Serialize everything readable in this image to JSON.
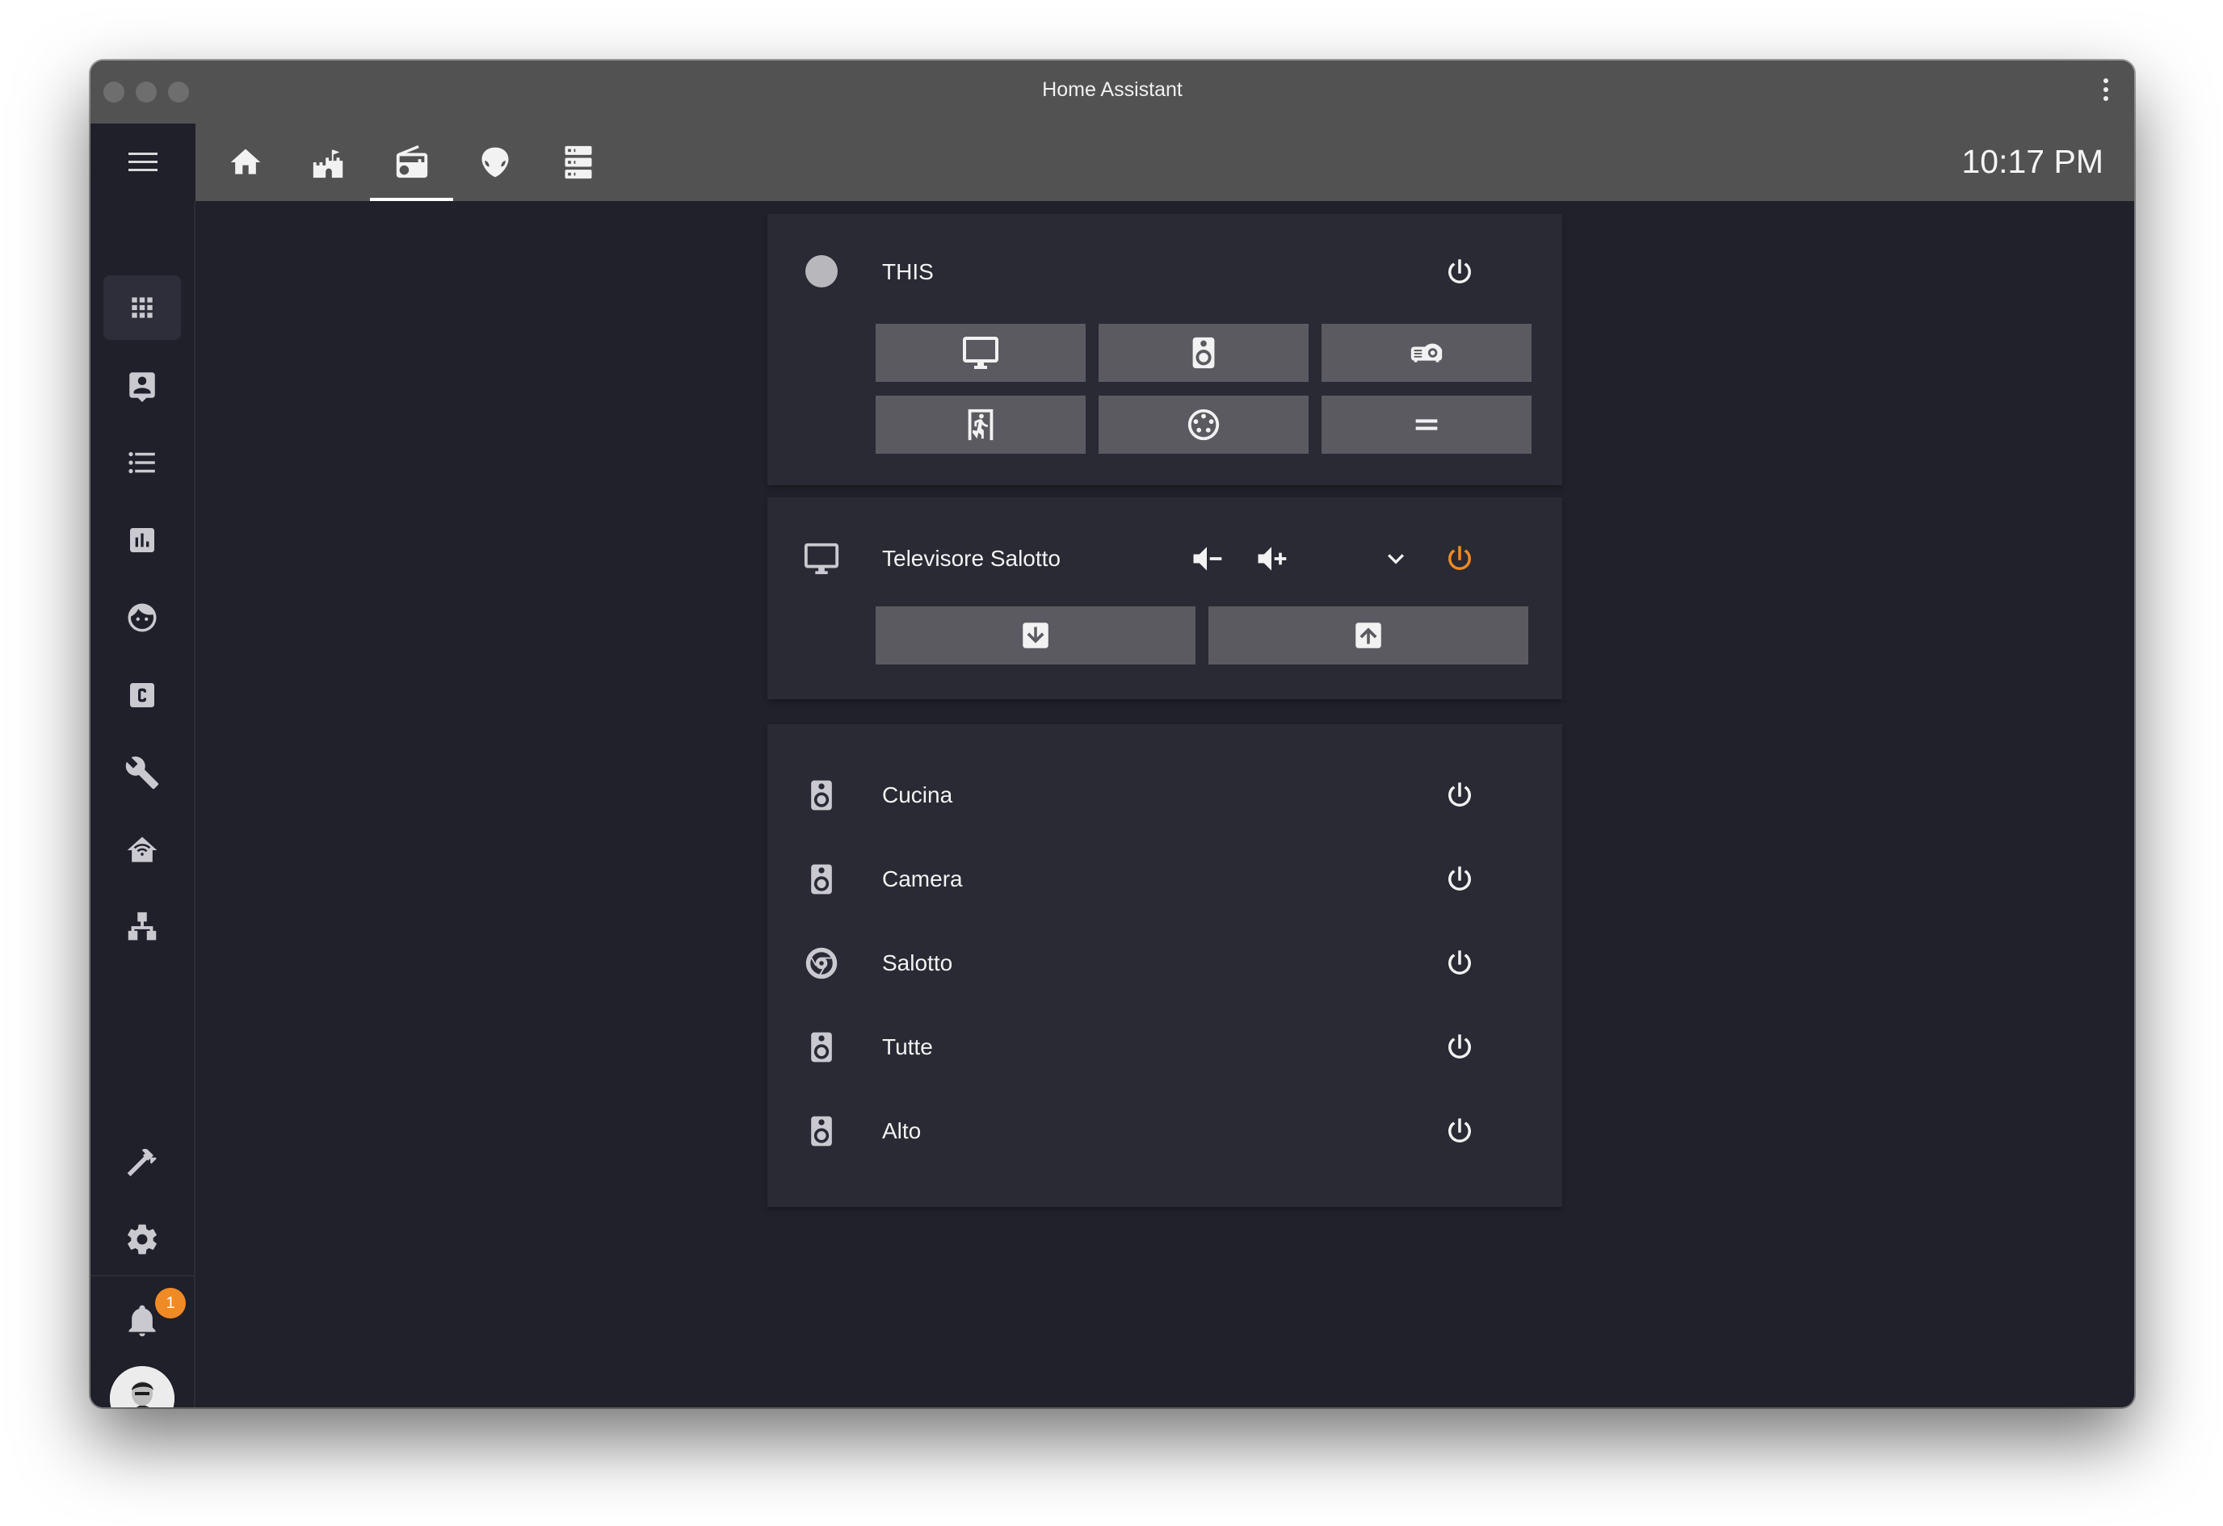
{
  "window": {
    "title": "Home Assistant"
  },
  "toolbar": {
    "clock": "10:17 PM",
    "tabs": [
      {
        "icon": "home-icon"
      },
      {
        "icon": "castle-icon"
      },
      {
        "icon": "radio-icon",
        "active": true
      },
      {
        "icon": "alien-icon"
      },
      {
        "icon": "server-icon"
      }
    ]
  },
  "sidebar": {
    "items": [
      {
        "icon": "apps-icon",
        "active": true
      },
      {
        "icon": "account-box-icon"
      },
      {
        "icon": "format-list-icon"
      },
      {
        "icon": "chart-box-icon"
      },
      {
        "icon": "face-icon"
      },
      {
        "icon": "alpha-c-box-icon"
      },
      {
        "icon": "wrench-icon"
      },
      {
        "icon": "home-automation-icon"
      },
      {
        "icon": "sitemap-icon"
      },
      {
        "icon": "hammer-icon"
      },
      {
        "icon": "cog-icon"
      }
    ],
    "notifications": {
      "count": "1"
    }
  },
  "cards": {
    "source_card": {
      "label": "THIS",
      "buttons": [
        "monitor-icon",
        "speaker-icon",
        "projector-icon",
        "exit-run-icon",
        "dots-circle-icon",
        "equal-icon"
      ]
    },
    "tv_card": {
      "label": "Televisore Salotto",
      "power_color": "#f08a24",
      "buttons": [
        "arrow-down-box-icon",
        "arrow-up-box-icon"
      ]
    },
    "speakers_card": {
      "items": [
        {
          "label": "Cucina",
          "icon": "speaker-icon"
        },
        {
          "label": "Camera",
          "icon": "speaker-icon"
        },
        {
          "label": "Salotto",
          "icon": "google-chrome-icon"
        },
        {
          "label": "Tutte",
          "icon": "speaker-icon"
        },
        {
          "label": "Alto",
          "icon": "speaker-icon"
        }
      ]
    }
  },
  "colors": {
    "background": "#20212a",
    "card": "#292a33",
    "toolbar": "#525252",
    "accent_orange": "#f08a24"
  }
}
